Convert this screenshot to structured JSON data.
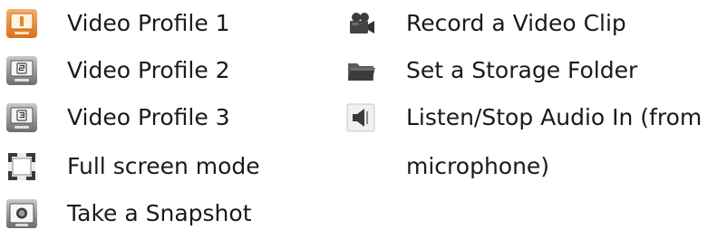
{
  "left_column": [
    {
      "label": "Video Profile 1",
      "icon": "video-profile-1-icon"
    },
    {
      "label": "Video Profile 2",
      "icon": "video-profile-2-icon"
    },
    {
      "label": "Video Profile 3",
      "icon": "video-profile-3-icon"
    },
    {
      "label": "Full screen mode",
      "icon": "fullscreen-icon"
    },
    {
      "label": "Take a Snapshot",
      "icon": "camera-icon"
    }
  ],
  "right_column": [
    {
      "label": "Record a Video Clip",
      "icon": "video-camera-icon"
    },
    {
      "label": "Set a Storage Folder",
      "icon": "folder-icon"
    },
    {
      "label": "Listen/Stop Audio In (from",
      "continuation": "microphone)",
      "icon": "speaker-icon"
    }
  ],
  "colors": {
    "active_orange": "#e8862a",
    "icon_gray": "#7a7a7a",
    "icon_dark": "#2e2e2e",
    "text": "#1a1a1a"
  }
}
